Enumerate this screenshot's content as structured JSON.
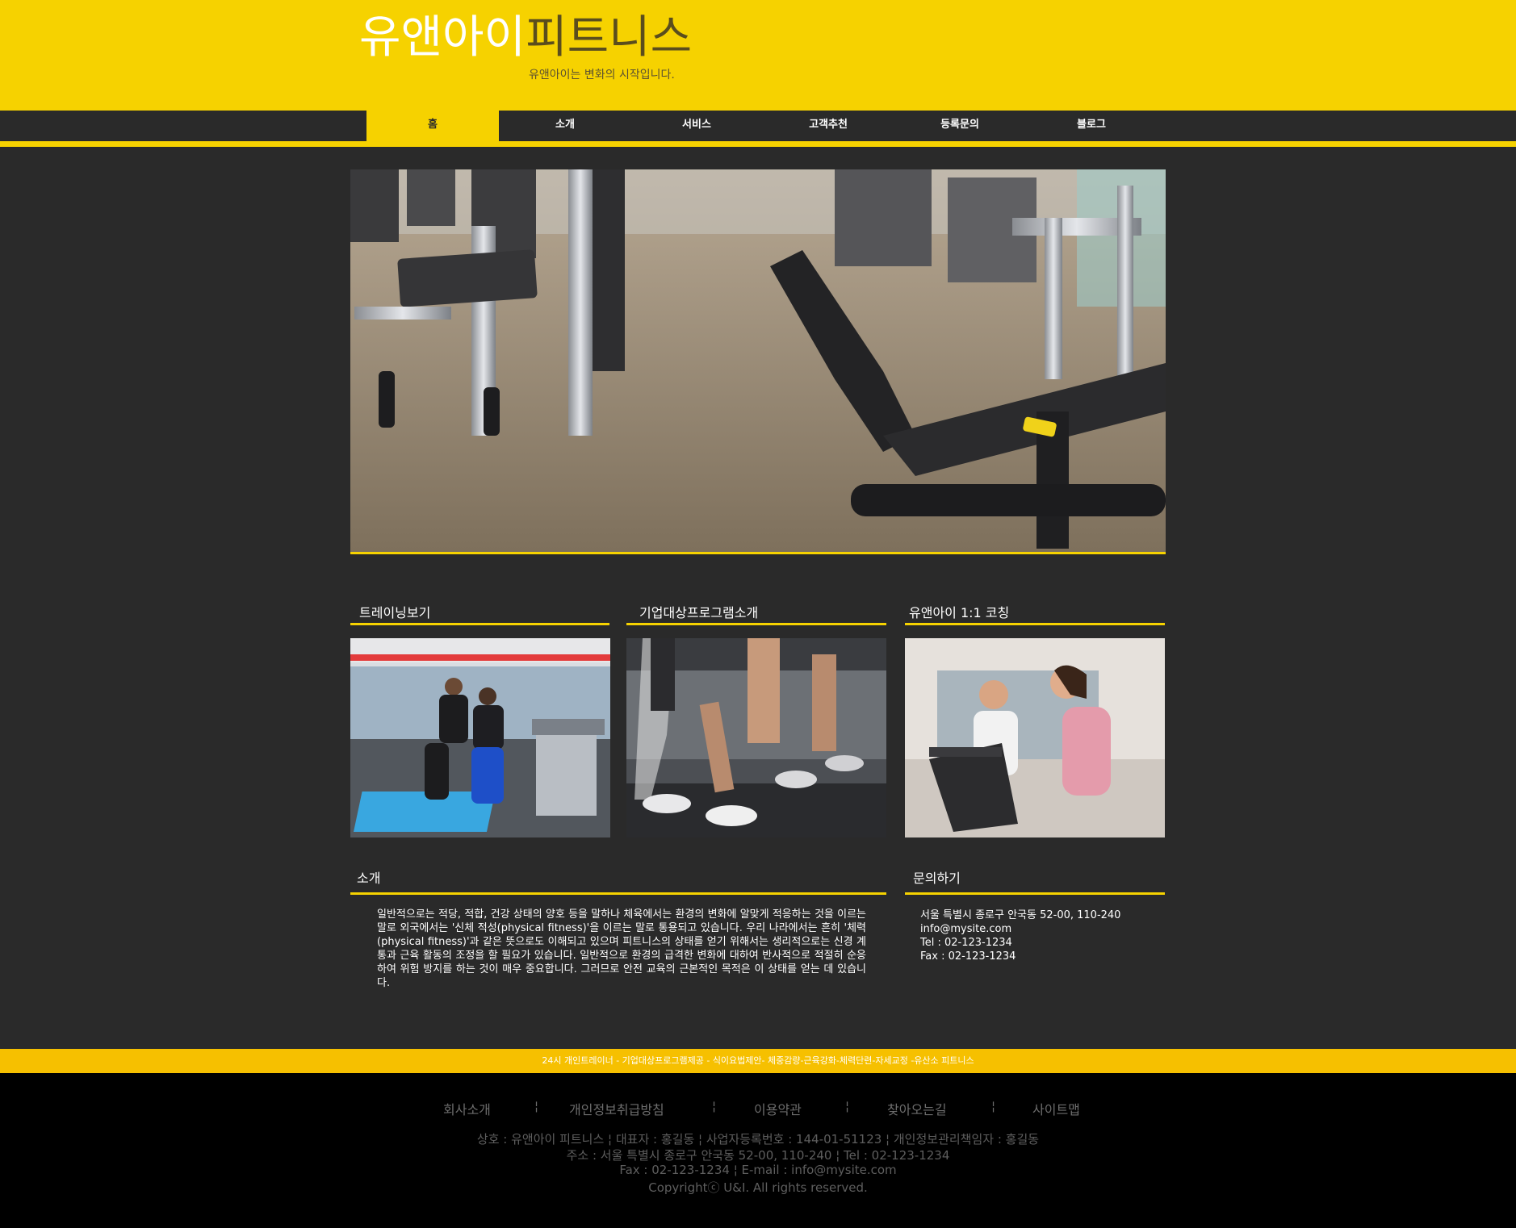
{
  "header": {
    "logo_part1": "유앤아이",
    "logo_part2": "피트니스",
    "tagline": "유앤아이는 변화의 시작입니다."
  },
  "nav": {
    "items": [
      "홈",
      "소개",
      "서비스",
      "고객추천",
      "등록문의",
      "블로그"
    ],
    "active": "홈"
  },
  "sections": {
    "training": "트레이닝보기",
    "corporate": "기업대상프로그램소개",
    "coaching": "유앤아이 1:1 코칭",
    "intro_title": "소개",
    "contact_title": "문의하기"
  },
  "intro_text": "일반적으로는 적당, 적합, 건강 상태의 양호 등을 말하나 체육에서는 환경의 변화에 알맞게 적응하는 것을 이르는 말로 외국에서는 '신체 적성(physical fitness)'을 이르는 말로 통용되고 있습니다. 우리 나라에서는 흔히 '체력(physical fitness)'과 같은 뜻으로도 이해되고 있으며 피트니스의 상태를 얻기 위해서는 생리적으로는 신경 계통과 근육 활동의 조정을 할 필요가 있습니다. 일반적으로 환경의 급격한 변화에 대하여 반사적으로 적절히 순응하여 위험 방지를 하는 것이 매우 중요합니다. 그러므로 안전 교육의 근본적인 목적은 이 상태를 얻는 데 있습니다.",
  "contact": {
    "address": "서울 특별시 종로구 안국동 52-00, 110-240",
    "email": "info@mysite.com",
    "tel": "Tel : 02-123-1234",
    "fax": "Fax : 02-123-1234"
  },
  "footer": {
    "strip": "24시 개인트레이너 - 기업대상프로그램제공 - 식이요법제안- 체중감량-근육강화-체력단련-자세교정 -유산소 피트니스",
    "links": [
      "회사소개",
      "개인정보취급방침",
      "이용약관",
      "찾아오는길",
      "사이트맵"
    ],
    "separator": "¦",
    "info_line1": "상호 : 유앤아이 피트니스 ¦ 대표자 : 홍길동 ¦ 사업자등록번호 : 144-01-51123 ¦ 개인정보관리책임자 : 홍길동",
    "info_line2": "주소 : 서울 특별시 종로구 안국동 52-00, 110-240 ¦ Tel : 02-123-1234",
    "info_line3": "Fax : 02-123-1234 ¦ E-mail : info@mysite.com",
    "copyright": "Copyrightⓒ U&I. All rights reserved."
  },
  "colors": {
    "brand_yellow": "#f6d200",
    "dark_bg": "#2a2a2a",
    "footer_bg": "#000000"
  }
}
